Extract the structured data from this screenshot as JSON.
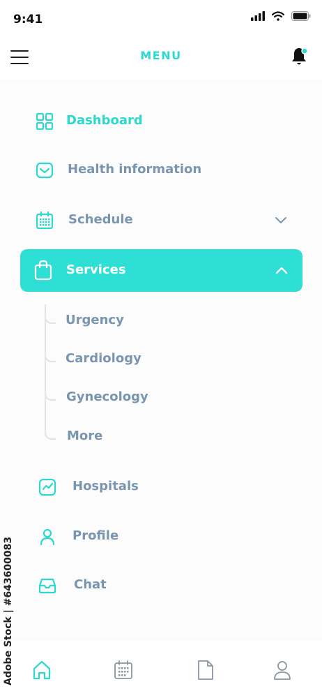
{
  "status_bar": {
    "time": "9:41"
  },
  "header": {
    "title": "MENU"
  },
  "colors": {
    "accent": "#2bd9cf",
    "muted_text": "#7a95b0",
    "active_bg": "#2ddfd4"
  },
  "menu": {
    "dashboard": "Dashboard",
    "health_information": "Health information",
    "schedule": "Schedule",
    "services": "Services",
    "services_submenu": [
      "Urgency",
      "Cardiology",
      "Gynecology",
      "More"
    ],
    "hospitals": "Hospitals",
    "profile": "Profile",
    "chat": "Chat"
  },
  "bottom_nav": {
    "tabs": [
      "home-icon",
      "calendar-icon",
      "document-icon",
      "user-icon"
    ],
    "active": "home-icon"
  },
  "watermark": "Adobe Stock | #643600083"
}
